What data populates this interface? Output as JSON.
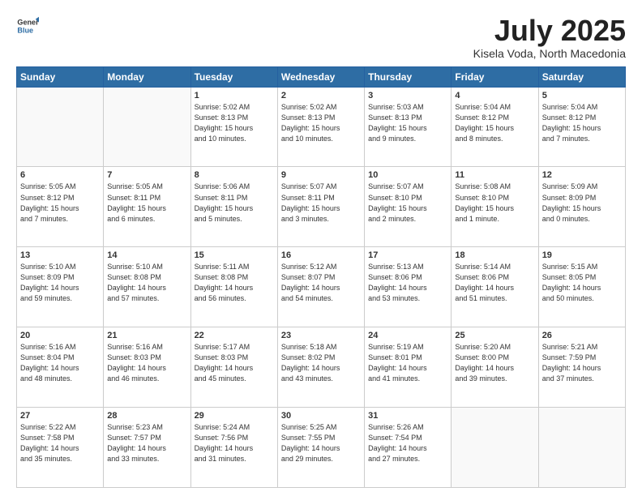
{
  "header": {
    "logo_general": "General",
    "logo_blue": "Blue",
    "month_title": "July 2025",
    "location": "Kisela Voda, North Macedonia"
  },
  "weekdays": [
    "Sunday",
    "Monday",
    "Tuesday",
    "Wednesday",
    "Thursday",
    "Friday",
    "Saturday"
  ],
  "weeks": [
    [
      {
        "day": "",
        "info": ""
      },
      {
        "day": "",
        "info": ""
      },
      {
        "day": "1",
        "info": "Sunrise: 5:02 AM\nSunset: 8:13 PM\nDaylight: 15 hours\nand 10 minutes."
      },
      {
        "day": "2",
        "info": "Sunrise: 5:02 AM\nSunset: 8:13 PM\nDaylight: 15 hours\nand 10 minutes."
      },
      {
        "day": "3",
        "info": "Sunrise: 5:03 AM\nSunset: 8:13 PM\nDaylight: 15 hours\nand 9 minutes."
      },
      {
        "day": "4",
        "info": "Sunrise: 5:04 AM\nSunset: 8:12 PM\nDaylight: 15 hours\nand 8 minutes."
      },
      {
        "day": "5",
        "info": "Sunrise: 5:04 AM\nSunset: 8:12 PM\nDaylight: 15 hours\nand 7 minutes."
      }
    ],
    [
      {
        "day": "6",
        "info": "Sunrise: 5:05 AM\nSunset: 8:12 PM\nDaylight: 15 hours\nand 7 minutes."
      },
      {
        "day": "7",
        "info": "Sunrise: 5:05 AM\nSunset: 8:11 PM\nDaylight: 15 hours\nand 6 minutes."
      },
      {
        "day": "8",
        "info": "Sunrise: 5:06 AM\nSunset: 8:11 PM\nDaylight: 15 hours\nand 5 minutes."
      },
      {
        "day": "9",
        "info": "Sunrise: 5:07 AM\nSunset: 8:11 PM\nDaylight: 15 hours\nand 3 minutes."
      },
      {
        "day": "10",
        "info": "Sunrise: 5:07 AM\nSunset: 8:10 PM\nDaylight: 15 hours\nand 2 minutes."
      },
      {
        "day": "11",
        "info": "Sunrise: 5:08 AM\nSunset: 8:10 PM\nDaylight: 15 hours\nand 1 minute."
      },
      {
        "day": "12",
        "info": "Sunrise: 5:09 AM\nSunset: 8:09 PM\nDaylight: 15 hours\nand 0 minutes."
      }
    ],
    [
      {
        "day": "13",
        "info": "Sunrise: 5:10 AM\nSunset: 8:09 PM\nDaylight: 14 hours\nand 59 minutes."
      },
      {
        "day": "14",
        "info": "Sunrise: 5:10 AM\nSunset: 8:08 PM\nDaylight: 14 hours\nand 57 minutes."
      },
      {
        "day": "15",
        "info": "Sunrise: 5:11 AM\nSunset: 8:08 PM\nDaylight: 14 hours\nand 56 minutes."
      },
      {
        "day": "16",
        "info": "Sunrise: 5:12 AM\nSunset: 8:07 PM\nDaylight: 14 hours\nand 54 minutes."
      },
      {
        "day": "17",
        "info": "Sunrise: 5:13 AM\nSunset: 8:06 PM\nDaylight: 14 hours\nand 53 minutes."
      },
      {
        "day": "18",
        "info": "Sunrise: 5:14 AM\nSunset: 8:06 PM\nDaylight: 14 hours\nand 51 minutes."
      },
      {
        "day": "19",
        "info": "Sunrise: 5:15 AM\nSunset: 8:05 PM\nDaylight: 14 hours\nand 50 minutes."
      }
    ],
    [
      {
        "day": "20",
        "info": "Sunrise: 5:16 AM\nSunset: 8:04 PM\nDaylight: 14 hours\nand 48 minutes."
      },
      {
        "day": "21",
        "info": "Sunrise: 5:16 AM\nSunset: 8:03 PM\nDaylight: 14 hours\nand 46 minutes."
      },
      {
        "day": "22",
        "info": "Sunrise: 5:17 AM\nSunset: 8:03 PM\nDaylight: 14 hours\nand 45 minutes."
      },
      {
        "day": "23",
        "info": "Sunrise: 5:18 AM\nSunset: 8:02 PM\nDaylight: 14 hours\nand 43 minutes."
      },
      {
        "day": "24",
        "info": "Sunrise: 5:19 AM\nSunset: 8:01 PM\nDaylight: 14 hours\nand 41 minutes."
      },
      {
        "day": "25",
        "info": "Sunrise: 5:20 AM\nSunset: 8:00 PM\nDaylight: 14 hours\nand 39 minutes."
      },
      {
        "day": "26",
        "info": "Sunrise: 5:21 AM\nSunset: 7:59 PM\nDaylight: 14 hours\nand 37 minutes."
      }
    ],
    [
      {
        "day": "27",
        "info": "Sunrise: 5:22 AM\nSunset: 7:58 PM\nDaylight: 14 hours\nand 35 minutes."
      },
      {
        "day": "28",
        "info": "Sunrise: 5:23 AM\nSunset: 7:57 PM\nDaylight: 14 hours\nand 33 minutes."
      },
      {
        "day": "29",
        "info": "Sunrise: 5:24 AM\nSunset: 7:56 PM\nDaylight: 14 hours\nand 31 minutes."
      },
      {
        "day": "30",
        "info": "Sunrise: 5:25 AM\nSunset: 7:55 PM\nDaylight: 14 hours\nand 29 minutes."
      },
      {
        "day": "31",
        "info": "Sunrise: 5:26 AM\nSunset: 7:54 PM\nDaylight: 14 hours\nand 27 minutes."
      },
      {
        "day": "",
        "info": ""
      },
      {
        "day": "",
        "info": ""
      }
    ]
  ]
}
